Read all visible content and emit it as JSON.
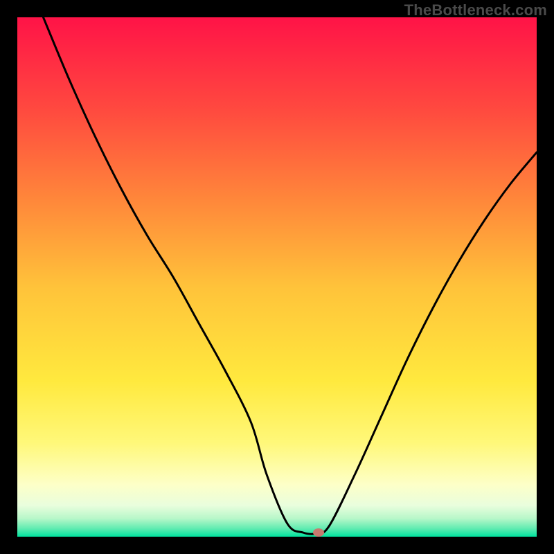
{
  "watermark": "TheBottleneck.com",
  "chart_data": {
    "type": "line",
    "title": "",
    "xlabel": "",
    "ylabel": "",
    "xlim": [
      0,
      100
    ],
    "ylim": [
      0,
      100
    ],
    "grid": false,
    "legend_position": "none",
    "background_gradient": {
      "stops": [
        {
          "pos": 0.0,
          "color": "#ff1347"
        },
        {
          "pos": 0.18,
          "color": "#ff4a3f"
        },
        {
          "pos": 0.36,
          "color": "#ff8a3a"
        },
        {
          "pos": 0.52,
          "color": "#ffc33a"
        },
        {
          "pos": 0.7,
          "color": "#ffe93e"
        },
        {
          "pos": 0.82,
          "color": "#fff87a"
        },
        {
          "pos": 0.9,
          "color": "#fdffc8"
        },
        {
          "pos": 0.94,
          "color": "#e9fedd"
        },
        {
          "pos": 0.965,
          "color": "#b7f7c9"
        },
        {
          "pos": 0.985,
          "color": "#5cebb0"
        },
        {
          "pos": 1.0,
          "color": "#00e39f"
        }
      ]
    },
    "curve": {
      "x": [
        5,
        10,
        15,
        20,
        25,
        30,
        35,
        40,
        45,
        48,
        52,
        55,
        57.5,
        60,
        65,
        70,
        75,
        80,
        85,
        90,
        95,
        100
      ],
      "y": [
        100,
        88,
        77,
        67,
        58,
        50,
        41,
        32,
        22,
        12,
        2.5,
        0.8,
        0.6,
        2,
        12,
        23,
        34,
        44,
        53,
        61,
        68,
        74
      ]
    },
    "marker": {
      "x": 58,
      "y": 0.8,
      "color": "#c77a6f",
      "rx": 8,
      "ry": 6
    }
  }
}
